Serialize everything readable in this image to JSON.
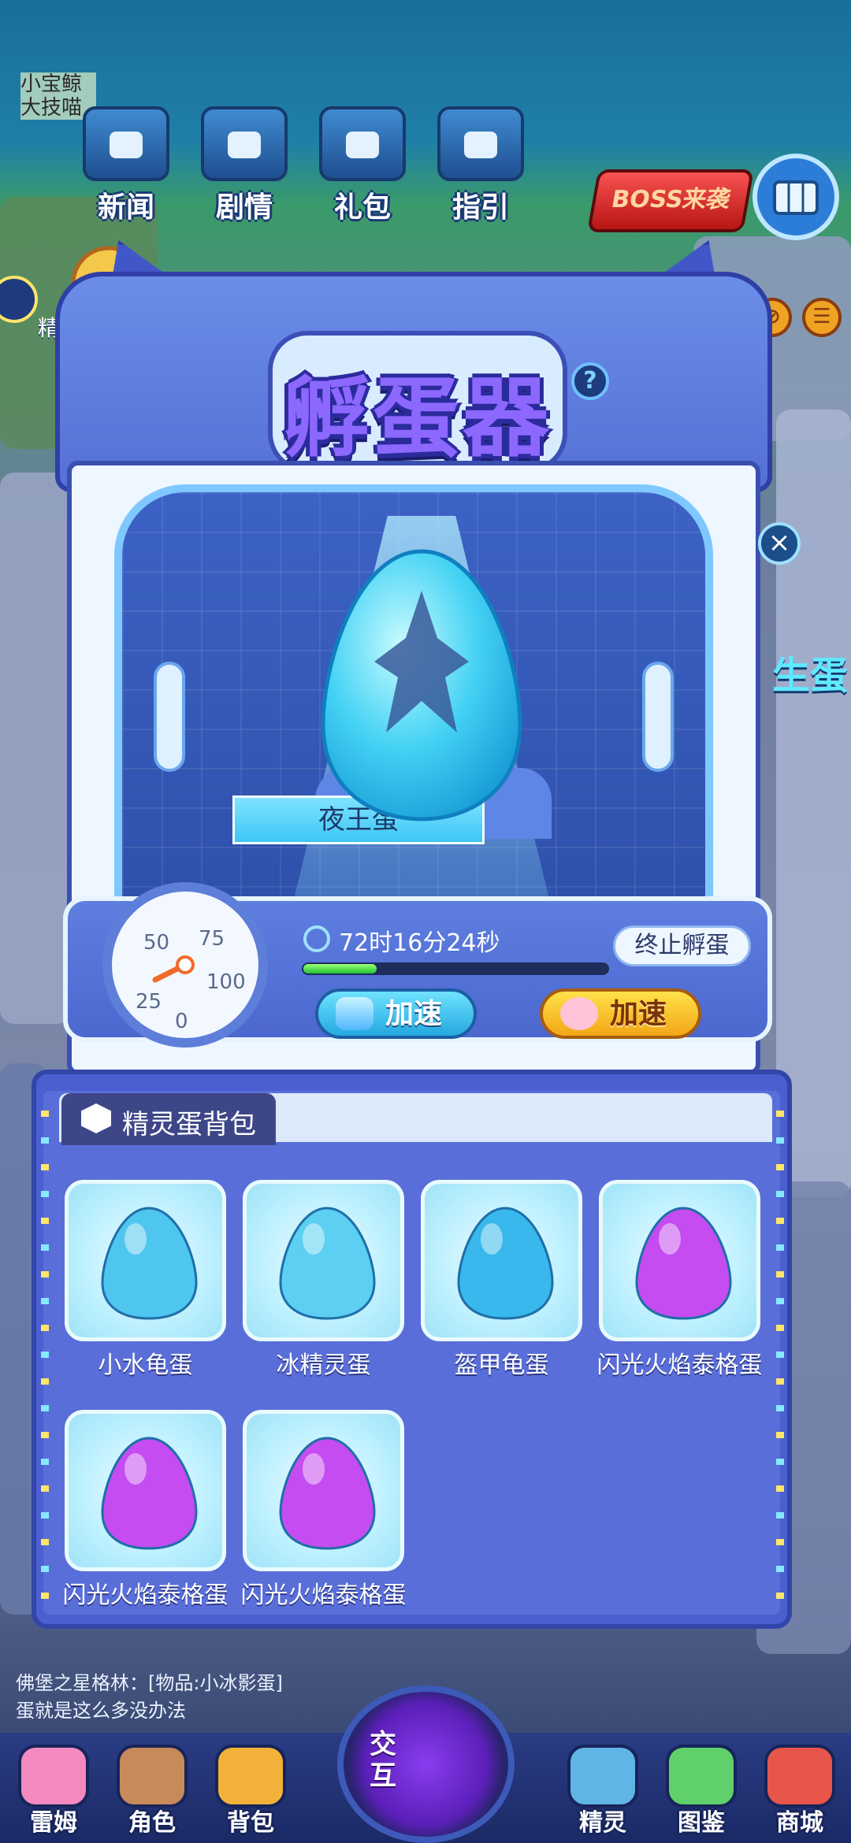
{
  "watermark": "小宝鲸\n大技喵",
  "top_menu": [
    {
      "label": "新闻",
      "icon": "news-tv-icon"
    },
    {
      "label": "剧情",
      "icon": "story-chest-icon"
    },
    {
      "label": "礼包",
      "icon": "gift-chest-icon"
    },
    {
      "label": "指引",
      "icon": "guide-chest-icon"
    }
  ],
  "boss_banner": "BOSS来袭",
  "elf_war_label": "精灵战令",
  "side_partial_text": "生蛋",
  "incubator": {
    "title": "孵蛋器",
    "help": "?",
    "egg_name": "夜王蛋",
    "timer": "72时16分24秒",
    "progress": 0.24,
    "stop_label": "终止孵蛋",
    "speed_gem_label": "加速",
    "speed_pet_label": "加速",
    "gauge": {
      "ticks": [
        "0",
        "25",
        "50",
        "75",
        "100"
      ]
    }
  },
  "backpack": {
    "tab_label": "精灵蛋背包",
    "eggs": [
      {
        "name": "小水龟蛋",
        "color": "#4fc6ef"
      },
      {
        "name": "冰精灵蛋",
        "color": "#5ccff2"
      },
      {
        "name": "盔甲龟蛋",
        "color": "#38b8ec"
      },
      {
        "name": "闪光火焰泰格蛋",
        "color": "#c44cf0"
      },
      {
        "name": "闪光火焰泰格蛋",
        "color": "#c44cf0"
      },
      {
        "name": "闪光火焰泰格蛋",
        "color": "#c44cf0"
      }
    ]
  },
  "chat": {
    "line1": "佛堡之星格林：[物品:小冰影蛋]",
    "line2": "蛋就是这么多没办法"
  },
  "bottom_nav": [
    {
      "label": "雷姆",
      "color": "#f28ac0"
    },
    {
      "label": "角色",
      "color": "#c98a5a"
    },
    {
      "label": "背包",
      "color": "#f2b23a"
    },
    {
      "label": "精灵",
      "color": "#5fb5e6"
    },
    {
      "label": "图鉴",
      "color": "#5fd06a"
    },
    {
      "label": "商城",
      "color": "#e8554a"
    }
  ],
  "interact_label": "交互",
  "close_symbol": "×"
}
